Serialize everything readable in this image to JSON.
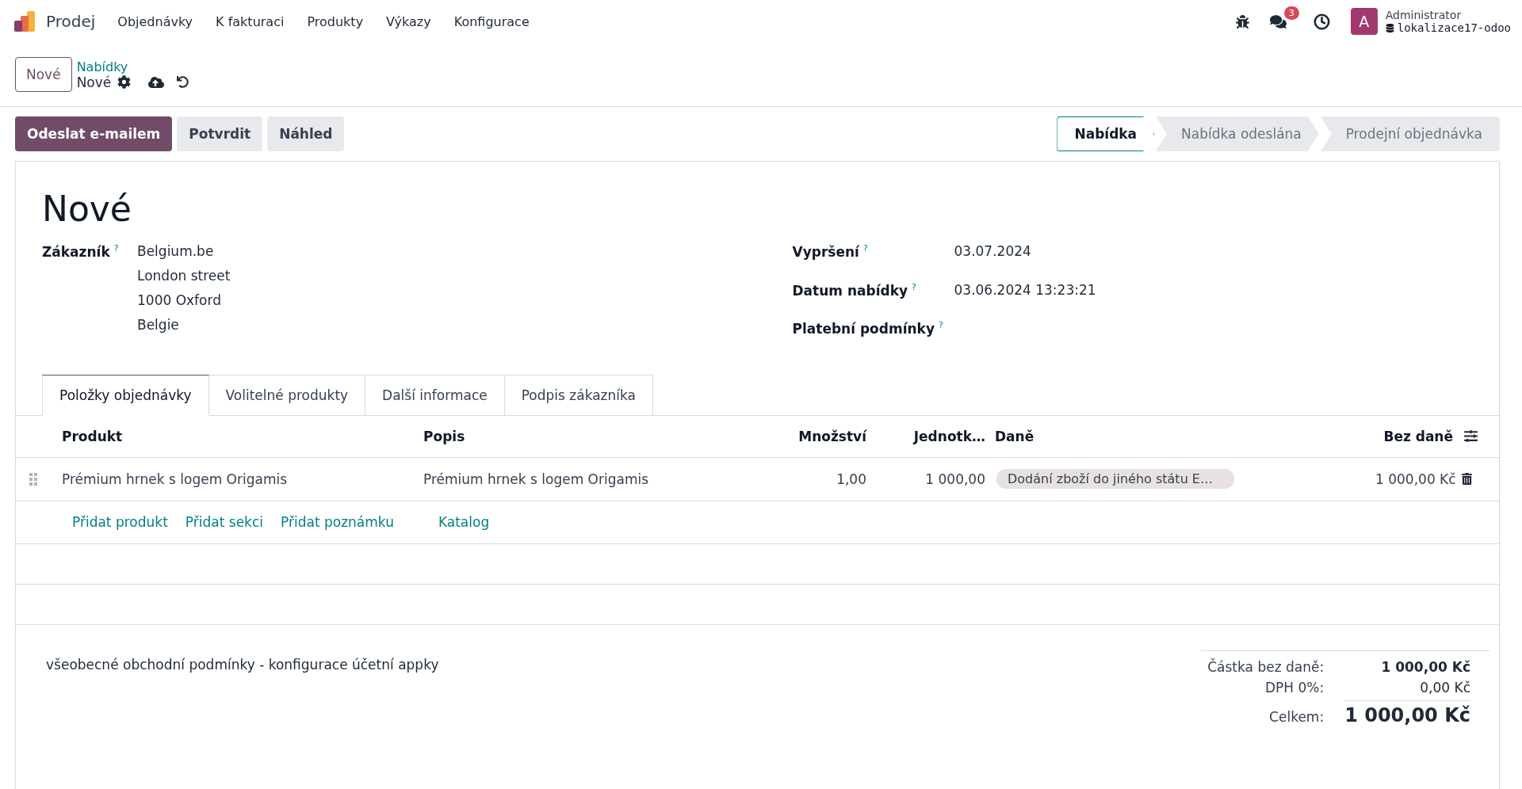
{
  "navbar": {
    "app": "Prodej",
    "menu": [
      "Objednávky",
      "K fakturaci",
      "Produkty",
      "Výkazy",
      "Konfigurace"
    ],
    "messages_badge": "3",
    "user": {
      "avatar": "A",
      "name": "Administrator",
      "database": "lokalizace17-odoo"
    }
  },
  "control_panel": {
    "new_button": "Nové",
    "breadcrumb": "Nabídky",
    "record": "Nové"
  },
  "actions": [
    {
      "label": "Odeslat e-mailem",
      "primary": true
    },
    {
      "label": "Potvrdit",
      "primary": false
    },
    {
      "label": "Náhled",
      "primary": false
    }
  ],
  "statusbar": [
    {
      "label": "Nabídka",
      "selected": true
    },
    {
      "label": "Nabídka odeslána",
      "selected": false
    },
    {
      "label": "Prodejní objednávka",
      "selected": false
    }
  ],
  "form": {
    "title": "Nové",
    "left_fields": [
      {
        "label": "Zákazník",
        "help": "?",
        "lines": [
          "Belgium.be",
          "London street",
          "1000 Oxford",
          "Belgie"
        ]
      }
    ],
    "right_fields": [
      {
        "label": "Vypršení",
        "help": "?",
        "lines": [
          "03.07.2024"
        ]
      },
      {
        "label": "Datum nabídky",
        "help": "?",
        "lines": [
          "03.06.2024 13:23:21"
        ]
      },
      {
        "label": "Platební podmínky",
        "help": "?"
      }
    ]
  },
  "tabs": [
    {
      "label": "Položky objednávky",
      "selected": true
    },
    {
      "label": "Volitelné produkty",
      "selected": false
    },
    {
      "label": "Další informace",
      "selected": false
    },
    {
      "label": "Podpis zákazníka",
      "selected": false
    }
  ],
  "table": {
    "columns": [
      "Produkt",
      "Popis",
      "Množství",
      "Jednotk…",
      "Daně",
      "Bez daně"
    ],
    "rows": [
      {
        "product": "Prémium hrnek s logem Origamis",
        "description": "Prémium hrnek s logem Origamis",
        "quantity": "1,00",
        "unit_price": "1 000,00",
        "taxes": [
          "Dodání zboží do jiného státu E…"
        ],
        "subtotal": "1 000,00 Kč"
      }
    ],
    "add_links": [
      "Přidat produkt",
      "Přidat sekci",
      "Přidat poznámku",
      "Katalog"
    ]
  },
  "terms": "všeobecné obchodní podmínky - konfigurace účetní appky",
  "totals": [
    {
      "label": "Částka bez daně:",
      "value": "1 000,00 Kč",
      "kind": "subtotal"
    },
    {
      "label": "DPH 0%:",
      "value": "0,00 Kč",
      "kind": "tax"
    },
    {
      "label": "Celkem:",
      "value": "1 000,00 Kč",
      "kind": "total"
    }
  ]
}
